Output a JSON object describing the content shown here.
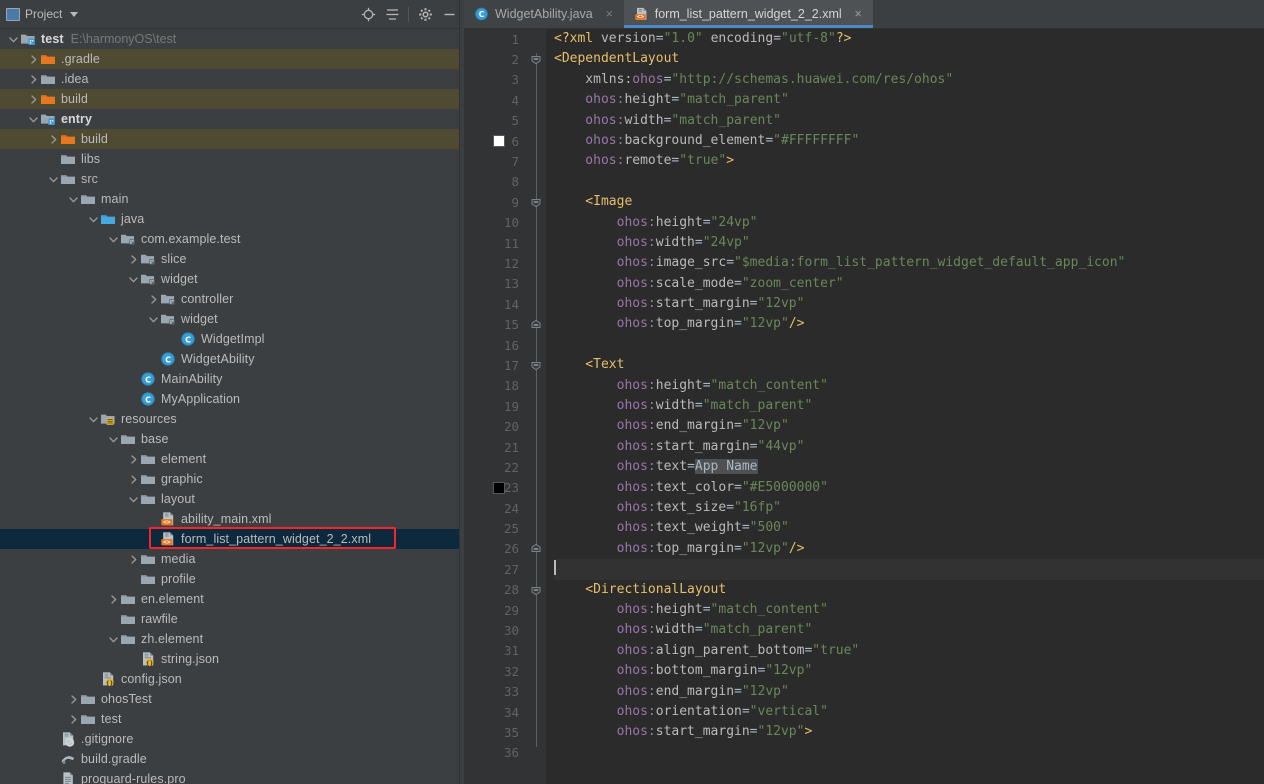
{
  "panel": {
    "title": "Project",
    "icons": {
      "project": "project-icon",
      "caret": "chevron-down-icon",
      "locate": "locate-target-icon",
      "collapse": "collapse-all-icon",
      "settings": "gear-icon",
      "minimize": "minimize-icon"
    }
  },
  "tree": [
    {
      "label": "test",
      "sub": "E:\\harmonyOS\\test",
      "depth": 0,
      "arrow": "down",
      "icon": "module",
      "bold": true,
      "state": "normal"
    },
    {
      "label": ".gradle",
      "sub": "",
      "depth": 1,
      "arrow": "right",
      "icon": "folder-orange",
      "bold": false,
      "state": "excluded"
    },
    {
      "label": ".idea",
      "sub": "",
      "depth": 1,
      "arrow": "right",
      "icon": "folder",
      "bold": false,
      "state": "normal"
    },
    {
      "label": "build",
      "sub": "",
      "depth": 1,
      "arrow": "right",
      "icon": "folder-orange",
      "bold": false,
      "state": "excluded"
    },
    {
      "label": "entry",
      "sub": "",
      "depth": 1,
      "arrow": "down",
      "icon": "module",
      "bold": true,
      "state": "normal"
    },
    {
      "label": "build",
      "sub": "",
      "depth": 2,
      "arrow": "right",
      "icon": "folder-orange",
      "bold": false,
      "state": "excluded"
    },
    {
      "label": "libs",
      "sub": "",
      "depth": 2,
      "arrow": "none",
      "icon": "folder",
      "bold": false,
      "state": "normal"
    },
    {
      "label": "src",
      "sub": "",
      "depth": 2,
      "arrow": "down",
      "icon": "folder",
      "bold": false,
      "state": "normal"
    },
    {
      "label": "main",
      "sub": "",
      "depth": 3,
      "arrow": "down",
      "icon": "folder",
      "bold": false,
      "state": "normal"
    },
    {
      "label": "java",
      "sub": "",
      "depth": 4,
      "arrow": "down",
      "icon": "folder-source",
      "bold": false,
      "state": "normal"
    },
    {
      "label": "com.example.test",
      "sub": "",
      "depth": 5,
      "arrow": "down",
      "icon": "package",
      "bold": false,
      "state": "normal"
    },
    {
      "label": "slice",
      "sub": "",
      "depth": 6,
      "arrow": "right",
      "icon": "package",
      "bold": false,
      "state": "normal"
    },
    {
      "label": "widget",
      "sub": "",
      "depth": 6,
      "arrow": "down",
      "icon": "package",
      "bold": false,
      "state": "normal"
    },
    {
      "label": "controller",
      "sub": "",
      "depth": 7,
      "arrow": "right",
      "icon": "package",
      "bold": false,
      "state": "normal"
    },
    {
      "label": "widget",
      "sub": "",
      "depth": 7,
      "arrow": "down",
      "icon": "package",
      "bold": false,
      "state": "normal"
    },
    {
      "label": "WidgetImpl",
      "sub": "",
      "depth": 8,
      "arrow": "none",
      "icon": "class",
      "bold": false,
      "state": "normal"
    },
    {
      "label": "WidgetAbility",
      "sub": "",
      "depth": 7,
      "arrow": "none",
      "icon": "class",
      "bold": false,
      "state": "normal"
    },
    {
      "label": "MainAbility",
      "sub": "",
      "depth": 6,
      "arrow": "none",
      "icon": "class",
      "bold": false,
      "state": "normal"
    },
    {
      "label": "MyApplication",
      "sub": "",
      "depth": 6,
      "arrow": "none",
      "icon": "class",
      "bold": false,
      "state": "normal"
    },
    {
      "label": "resources",
      "sub": "",
      "depth": 4,
      "arrow": "down",
      "icon": "folder-res",
      "bold": false,
      "state": "normal"
    },
    {
      "label": "base",
      "sub": "",
      "depth": 5,
      "arrow": "down",
      "icon": "folder",
      "bold": false,
      "state": "normal"
    },
    {
      "label": "element",
      "sub": "",
      "depth": 6,
      "arrow": "right",
      "icon": "folder",
      "bold": false,
      "state": "normal"
    },
    {
      "label": "graphic",
      "sub": "",
      "depth": 6,
      "arrow": "right",
      "icon": "folder",
      "bold": false,
      "state": "normal"
    },
    {
      "label": "layout",
      "sub": "",
      "depth": 6,
      "arrow": "down",
      "icon": "folder",
      "bold": false,
      "state": "normal"
    },
    {
      "label": "ability_main.xml",
      "sub": "",
      "depth": 7,
      "arrow": "none",
      "icon": "xml",
      "bold": false,
      "state": "normal"
    },
    {
      "label": "form_list_pattern_widget_2_2.xml",
      "sub": "",
      "depth": 7,
      "arrow": "none",
      "icon": "xml",
      "bold": false,
      "state": "selected"
    },
    {
      "label": "media",
      "sub": "",
      "depth": 6,
      "arrow": "right",
      "icon": "folder",
      "bold": false,
      "state": "normal"
    },
    {
      "label": "profile",
      "sub": "",
      "depth": 6,
      "arrow": "none",
      "icon": "folder",
      "bold": false,
      "state": "normal"
    },
    {
      "label": "en.element",
      "sub": "",
      "depth": 5,
      "arrow": "right",
      "icon": "folder",
      "bold": false,
      "state": "normal"
    },
    {
      "label": "rawfile",
      "sub": "",
      "depth": 5,
      "arrow": "none",
      "icon": "folder",
      "bold": false,
      "state": "normal"
    },
    {
      "label": "zh.element",
      "sub": "",
      "depth": 5,
      "arrow": "down",
      "icon": "folder",
      "bold": false,
      "state": "normal"
    },
    {
      "label": "string.json",
      "sub": "",
      "depth": 6,
      "arrow": "none",
      "icon": "json",
      "bold": false,
      "state": "normal"
    },
    {
      "label": "config.json",
      "sub": "",
      "depth": 4,
      "arrow": "none",
      "icon": "json",
      "bold": false,
      "state": "normal"
    },
    {
      "label": "ohosTest",
      "sub": "",
      "depth": 3,
      "arrow": "right",
      "icon": "folder",
      "bold": false,
      "state": "normal"
    },
    {
      "label": "test",
      "sub": "",
      "depth": 3,
      "arrow": "right",
      "icon": "folder",
      "bold": false,
      "state": "normal"
    },
    {
      "label": ".gitignore",
      "sub": "",
      "depth": 2,
      "arrow": "none",
      "icon": "gitignore",
      "bold": false,
      "state": "normal"
    },
    {
      "label": "build.gradle",
      "sub": "",
      "depth": 2,
      "arrow": "none",
      "icon": "gradle",
      "bold": false,
      "state": "normal"
    },
    {
      "label": "proguard-rules.pro",
      "sub": "",
      "depth": 2,
      "arrow": "none",
      "icon": "text",
      "bold": false,
      "state": "normal"
    }
  ],
  "tabs": [
    {
      "label": "WidgetAbility.java",
      "icon": "class",
      "active": false,
      "close": "×"
    },
    {
      "label": "form_list_pattern_widget_2_2.xml",
      "icon": "xml",
      "active": true,
      "close": "×"
    }
  ],
  "editor": {
    "first_line": 1,
    "last_line": 36,
    "current_line": 27,
    "color_swatches": [
      {
        "line": 6,
        "color": "#FFFFFF"
      },
      {
        "line": 23,
        "color": "#000000"
      }
    ],
    "fold_markers": [
      2,
      9,
      15,
      17,
      26,
      28
    ],
    "lines": [
      {
        "n": 1,
        "tokens": [
          {
            "t": "<?xml ",
            "c": "t-pi"
          },
          {
            "t": "version",
            "c": "t-attr"
          },
          {
            "t": "=",
            "c": "t-eq"
          },
          {
            "t": "\"1.0\"",
            "c": "t-str"
          },
          {
            "t": " ",
            "c": "t-plain"
          },
          {
            "t": "encoding",
            "c": "t-attr"
          },
          {
            "t": "=",
            "c": "t-eq"
          },
          {
            "t": "\"utf-8\"",
            "c": "t-str"
          },
          {
            "t": "?>",
            "c": "t-pi"
          }
        ]
      },
      {
        "n": 2,
        "tokens": [
          {
            "t": "<DependentLayout",
            "c": "t-tag"
          }
        ]
      },
      {
        "n": 3,
        "tokens": [
          {
            "t": "    xmlns:",
            "c": "t-attr"
          },
          {
            "t": "ohos",
            "c": "t-ns"
          },
          {
            "t": "=",
            "c": "t-eq"
          },
          {
            "t": "\"http://schemas.huawei.com/res/ohos\"",
            "c": "t-str"
          }
        ]
      },
      {
        "n": 4,
        "tokens": [
          {
            "t": "    ohos:",
            "c": "t-ns"
          },
          {
            "t": "height",
            "c": "t-attr"
          },
          {
            "t": "=",
            "c": "t-eq"
          },
          {
            "t": "\"match_parent\"",
            "c": "t-str"
          }
        ]
      },
      {
        "n": 5,
        "tokens": [
          {
            "t": "    ohos:",
            "c": "t-ns"
          },
          {
            "t": "width",
            "c": "t-attr"
          },
          {
            "t": "=",
            "c": "t-eq"
          },
          {
            "t": "\"match_parent\"",
            "c": "t-str"
          }
        ]
      },
      {
        "n": 6,
        "tokens": [
          {
            "t": "    ohos:",
            "c": "t-ns"
          },
          {
            "t": "background_element",
            "c": "t-attr"
          },
          {
            "t": "=",
            "c": "t-eq"
          },
          {
            "t": "\"#FFFFFFFF\"",
            "c": "t-str"
          }
        ]
      },
      {
        "n": 7,
        "tokens": [
          {
            "t": "    ohos:",
            "c": "t-ns"
          },
          {
            "t": "remote",
            "c": "t-attr"
          },
          {
            "t": "=",
            "c": "t-eq"
          },
          {
            "t": "\"true\"",
            "c": "t-str"
          },
          {
            "t": ">",
            "c": "t-close"
          }
        ]
      },
      {
        "n": 8,
        "tokens": []
      },
      {
        "n": 9,
        "tokens": [
          {
            "t": "    <Image",
            "c": "t-tag"
          }
        ]
      },
      {
        "n": 10,
        "tokens": [
          {
            "t": "        ohos:",
            "c": "t-ns"
          },
          {
            "t": "height",
            "c": "t-attr"
          },
          {
            "t": "=",
            "c": "t-eq"
          },
          {
            "t": "\"24vp\"",
            "c": "t-str"
          }
        ]
      },
      {
        "n": 11,
        "tokens": [
          {
            "t": "        ohos:",
            "c": "t-ns"
          },
          {
            "t": "width",
            "c": "t-attr"
          },
          {
            "t": "=",
            "c": "t-eq"
          },
          {
            "t": "\"24vp\"",
            "c": "t-str"
          }
        ]
      },
      {
        "n": 12,
        "tokens": [
          {
            "t": "        ohos:",
            "c": "t-ns"
          },
          {
            "t": "image_src",
            "c": "t-attr"
          },
          {
            "t": "=",
            "c": "t-eq"
          },
          {
            "t": "\"$media:form_list_pattern_widget_default_app_icon\"",
            "c": "t-str"
          }
        ]
      },
      {
        "n": 13,
        "tokens": [
          {
            "t": "        ohos:",
            "c": "t-ns"
          },
          {
            "t": "scale_mode",
            "c": "t-attr"
          },
          {
            "t": "=",
            "c": "t-eq"
          },
          {
            "t": "\"zoom_center\"",
            "c": "t-str"
          }
        ]
      },
      {
        "n": 14,
        "tokens": [
          {
            "t": "        ohos:",
            "c": "t-ns"
          },
          {
            "t": "start_margin",
            "c": "t-attr"
          },
          {
            "t": "=",
            "c": "t-eq"
          },
          {
            "t": "\"12vp\"",
            "c": "t-str"
          }
        ]
      },
      {
        "n": 15,
        "tokens": [
          {
            "t": "        ohos:",
            "c": "t-ns"
          },
          {
            "t": "top_margin",
            "c": "t-attr"
          },
          {
            "t": "=",
            "c": "t-eq"
          },
          {
            "t": "\"12vp\"",
            "c": "t-str"
          },
          {
            "t": "/>",
            "c": "t-close"
          }
        ]
      },
      {
        "n": 16,
        "tokens": []
      },
      {
        "n": 17,
        "tokens": [
          {
            "t": "    <Text",
            "c": "t-tag"
          }
        ]
      },
      {
        "n": 18,
        "tokens": [
          {
            "t": "        ohos:",
            "c": "t-ns"
          },
          {
            "t": "height",
            "c": "t-attr"
          },
          {
            "t": "=",
            "c": "t-eq"
          },
          {
            "t": "\"match_content\"",
            "c": "t-str"
          }
        ]
      },
      {
        "n": 19,
        "tokens": [
          {
            "t": "        ohos:",
            "c": "t-ns"
          },
          {
            "t": "width",
            "c": "t-attr"
          },
          {
            "t": "=",
            "c": "t-eq"
          },
          {
            "t": "\"match_parent\"",
            "c": "t-str"
          }
        ]
      },
      {
        "n": 20,
        "tokens": [
          {
            "t": "        ohos:",
            "c": "t-ns"
          },
          {
            "t": "end_margin",
            "c": "t-attr"
          },
          {
            "t": "=",
            "c": "t-eq"
          },
          {
            "t": "\"12vp\"",
            "c": "t-str"
          }
        ]
      },
      {
        "n": 21,
        "tokens": [
          {
            "t": "        ohos:",
            "c": "t-ns"
          },
          {
            "t": "start_margin",
            "c": "t-attr"
          },
          {
            "t": "=",
            "c": "t-eq"
          },
          {
            "t": "\"44vp\"",
            "c": "t-str"
          }
        ]
      },
      {
        "n": 22,
        "tokens": [
          {
            "t": "        ohos:",
            "c": "t-ns"
          },
          {
            "t": "text",
            "c": "t-attr"
          },
          {
            "t": "=",
            "c": "t-eq"
          },
          {
            "t": "App Name",
            "c": "t-hl"
          }
        ]
      },
      {
        "n": 23,
        "tokens": [
          {
            "t": "        ohos:",
            "c": "t-ns"
          },
          {
            "t": "text_color",
            "c": "t-attr"
          },
          {
            "t": "=",
            "c": "t-eq"
          },
          {
            "t": "\"#E5000000\"",
            "c": "t-str"
          }
        ]
      },
      {
        "n": 24,
        "tokens": [
          {
            "t": "        ohos:",
            "c": "t-ns"
          },
          {
            "t": "text_size",
            "c": "t-attr"
          },
          {
            "t": "=",
            "c": "t-eq"
          },
          {
            "t": "\"16fp\"",
            "c": "t-str"
          }
        ]
      },
      {
        "n": 25,
        "tokens": [
          {
            "t": "        ohos:",
            "c": "t-ns"
          },
          {
            "t": "text_weight",
            "c": "t-attr"
          },
          {
            "t": "=",
            "c": "t-eq"
          },
          {
            "t": "\"500\"",
            "c": "t-str"
          }
        ]
      },
      {
        "n": 26,
        "tokens": [
          {
            "t": "        ohos:",
            "c": "t-ns"
          },
          {
            "t": "top_margin",
            "c": "t-attr"
          },
          {
            "t": "=",
            "c": "t-eq"
          },
          {
            "t": "\"12vp\"",
            "c": "t-str"
          },
          {
            "t": "/>",
            "c": "t-close"
          }
        ]
      },
      {
        "n": 27,
        "tokens": []
      },
      {
        "n": 28,
        "tokens": [
          {
            "t": "    <DirectionalLayout",
            "c": "t-tag"
          }
        ]
      },
      {
        "n": 29,
        "tokens": [
          {
            "t": "        ohos:",
            "c": "t-ns"
          },
          {
            "t": "height",
            "c": "t-attr"
          },
          {
            "t": "=",
            "c": "t-eq"
          },
          {
            "t": "\"match_content\"",
            "c": "t-str"
          }
        ]
      },
      {
        "n": 30,
        "tokens": [
          {
            "t": "        ohos:",
            "c": "t-ns"
          },
          {
            "t": "width",
            "c": "t-attr"
          },
          {
            "t": "=",
            "c": "t-eq"
          },
          {
            "t": "\"match_parent\"",
            "c": "t-str"
          }
        ]
      },
      {
        "n": 31,
        "tokens": [
          {
            "t": "        ohos:",
            "c": "t-ns"
          },
          {
            "t": "align_parent_bottom",
            "c": "t-attr"
          },
          {
            "t": "=",
            "c": "t-eq"
          },
          {
            "t": "\"true\"",
            "c": "t-str"
          }
        ]
      },
      {
        "n": 32,
        "tokens": [
          {
            "t": "        ohos:",
            "c": "t-ns"
          },
          {
            "t": "bottom_margin",
            "c": "t-attr"
          },
          {
            "t": "=",
            "c": "t-eq"
          },
          {
            "t": "\"12vp\"",
            "c": "t-str"
          }
        ]
      },
      {
        "n": 33,
        "tokens": [
          {
            "t": "        ohos:",
            "c": "t-ns"
          },
          {
            "t": "end_margin",
            "c": "t-attr"
          },
          {
            "t": "=",
            "c": "t-eq"
          },
          {
            "t": "\"12vp\"",
            "c": "t-str"
          }
        ]
      },
      {
        "n": 34,
        "tokens": [
          {
            "t": "        ohos:",
            "c": "t-ns"
          },
          {
            "t": "orientation",
            "c": "t-attr"
          },
          {
            "t": "=",
            "c": "t-eq"
          },
          {
            "t": "\"vertical\"",
            "c": "t-str"
          }
        ]
      },
      {
        "n": 35,
        "tokens": [
          {
            "t": "        ohos:",
            "c": "t-ns"
          },
          {
            "t": "start_margin",
            "c": "t-attr"
          },
          {
            "t": "=",
            "c": "t-eq"
          },
          {
            "t": "\"12vp\"",
            "c": "t-str"
          },
          {
            "t": ">",
            "c": "t-close"
          }
        ]
      },
      {
        "n": 36,
        "tokens": []
      }
    ]
  },
  "colors": {
    "panel_bg": "#3c3f41",
    "editor_bg": "#2b2b2b",
    "gutter_bg": "#313335",
    "selection": "#0d293e",
    "excluded": "#4f4b32",
    "highlight_box": "#f5252a",
    "tab_accent": "#4a88c7"
  }
}
